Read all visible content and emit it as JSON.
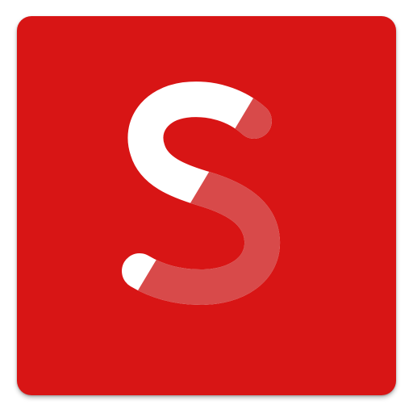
{
  "icon": {
    "name": "S app icon",
    "glyph": "S",
    "background_color": "#d81515",
    "glyph_color": "#ffffff",
    "overlay_color": "#d84a4a"
  }
}
